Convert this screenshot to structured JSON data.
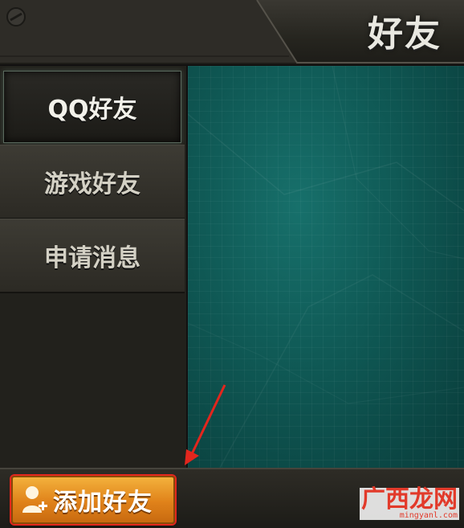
{
  "header": {
    "title": "好友"
  },
  "sidebar": {
    "items": [
      {
        "label": "QQ好友",
        "active": true
      },
      {
        "label": "游戏好友",
        "active": false
      },
      {
        "label": "申请消息",
        "active": false
      }
    ]
  },
  "bottom_bar": {
    "add_friend_label": "添加好友",
    "add_friend_icon": "add-user-icon"
  },
  "annotation": {
    "arrow_color": "#e3261d"
  },
  "watermark": {
    "logo": "广西龙网",
    "url": "mingyanl.com"
  },
  "colors": {
    "accent_orange": "#e0821a",
    "panel_teal": "#0f5854",
    "sidebar_dark": "#22211c"
  }
}
